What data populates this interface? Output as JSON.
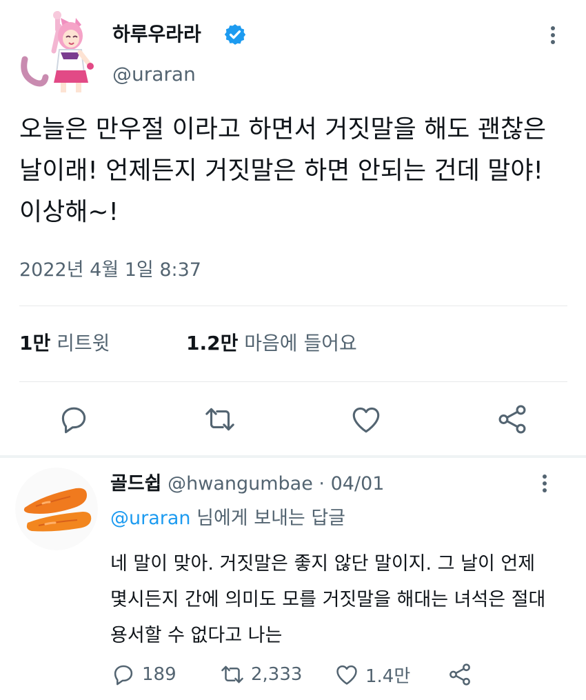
{
  "tweet": {
    "author": {
      "display_name": "하루우라라",
      "handle": "@uraran",
      "verified": true,
      "avatar_icon": "anime-catgirl-avatar"
    },
    "text_lines": [
      "오늘은 만우절 이라고 하면서 거짓말을 해도 괜찮은",
      "날이래! 언제든지 거짓말은 하면 안되는 건데 말야!",
      "이상해~!"
    ],
    "timestamp": "2022년 4월 1일 8:37",
    "stats": {
      "retweets_count": "1만",
      "retweets_label": "리트윗",
      "likes_count": "1.2만",
      "likes_label": "마음에 들어요"
    },
    "actions": [
      "reply-icon",
      "retweet-icon",
      "like-icon",
      "share-icon"
    ]
  },
  "reply": {
    "author_name": "골드쉽",
    "handle": "@hwangumbae",
    "separator": "·",
    "date": "04/01",
    "avatar_icon": "carrot-avatar",
    "reply_to_mention": "@uraran",
    "reply_to_suffix": "님에게 보내는 답글",
    "text_lines": [
      "네 말이 맞아. 거짓말은 좋지 않단 말이지. 그 날이 언제",
      "몇시든지 간에 의미도 모를 거짓말을 해대는 녀석은 절대",
      "용서할 수 없다고 나는"
    ],
    "counts": {
      "replies": "189",
      "retweets": "2,333",
      "likes": "1.4만"
    }
  },
  "colors": {
    "text": "#0f1419",
    "secondary": "#536471",
    "accent": "#1d9bf0",
    "divider": "#e7e9ea"
  }
}
